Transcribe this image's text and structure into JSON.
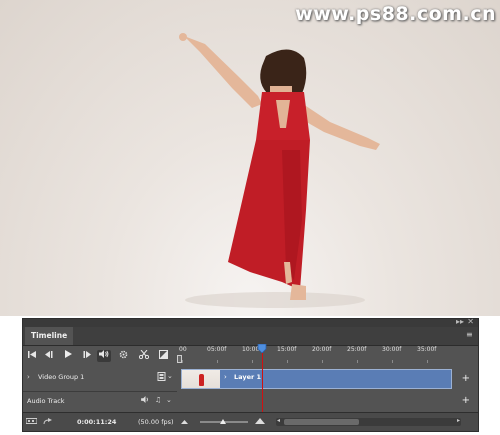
{
  "watermark": "www.ps88.com.cn",
  "panel": {
    "tab_title": "Timeline",
    "collapse_glyph": "▸▸",
    "close_glyph": "✕",
    "menu_glyph": "≡"
  },
  "transport": {
    "first_frame_icon": "go-to-first-frame-icon",
    "prev_frame_icon": "previous-frame-icon",
    "play_icon": "play-icon",
    "next_frame_icon": "next-frame-icon",
    "audio_icon": "audio-icon",
    "settings_icon": "gear-icon",
    "split_icon": "scissors-icon",
    "transition_icon": "transition-icon"
  },
  "ruler": {
    "ticks": [
      "00",
      "05:00f",
      "10:00f",
      "15:00f",
      "20:00f",
      "25:00f",
      "30:00f",
      "35:00f"
    ]
  },
  "tracks": {
    "video_group_label": "Video Group 1",
    "layer_label": "Layer 1",
    "audio_track_label": "Audio Track",
    "add_media_glyph": "+"
  },
  "status": {
    "current_time": "0:00:11:24",
    "frame_rate": "(50.00 fps)"
  },
  "colors": {
    "clip_blue": "#5a7db5",
    "playhead_red": "#d01010",
    "dress_red": "#c8202a"
  }
}
